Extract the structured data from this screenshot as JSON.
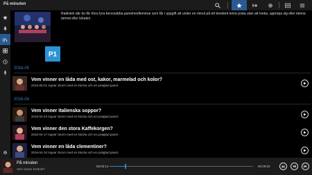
{
  "app": {
    "title": "På minuten"
  },
  "toolbar": {
    "more_label": "···"
  },
  "show": {
    "description": "Radiolek där du får höra fyra bensnabba panelmedlemmar som får i uppgift att under en minut på ett bestämt tema prata utan att tveka, upprepa sig eller lämna ämnet eller tokalen.",
    "logo_letter": "P1"
  },
  "sections": [
    {
      "year": "2016-05",
      "episodes": [
        {
          "title": "Vem vinner en låda med ost, kakor, marmelad och kolor?",
          "meta": "2016-05-01 Ingvar Storm med en klocka och en pratglad panel."
        }
      ]
    },
    {
      "year": "2016-04",
      "episodes": [
        {
          "title": "Vem vinner italienska soppor?",
          "meta": "2016-04-24 Ingvar Storm med en klocka och en pratglad panel."
        },
        {
          "title": "Vem vinner den stora Kaffekorgen?",
          "meta": "2016-04-17 Ingvar Storm med en klocka och en pratglad panel."
        },
        {
          "title": "Vem vinner en låda clementiner?",
          "meta": "2016-04-10 Ingvar Storm med en klocka och en pratglad panel."
        }
      ]
    }
  ],
  "player": {
    "title": "På minuten",
    "subtitle": "Vem vinner kontroll?",
    "elapsed": "00:03:14",
    "duration": "00:29:03",
    "progress": 0.11,
    "play_label": "▮▮"
  },
  "colors": {
    "accent": "#3a84cc",
    "active": "#2a5a93",
    "logo": "#2d93d6"
  },
  "icons": {
    "toolbar": [
      "search-icon",
      "favorite-star-icon",
      "share-icon",
      "settings-gear-icon",
      "list-icon",
      "menu-icon"
    ],
    "sidebar": [
      "favorites-star-icon",
      "microphone-icon",
      "programs-icon",
      "channels-icon",
      "history-icon",
      "pin-icon",
      "settings-gear-icon"
    ]
  }
}
